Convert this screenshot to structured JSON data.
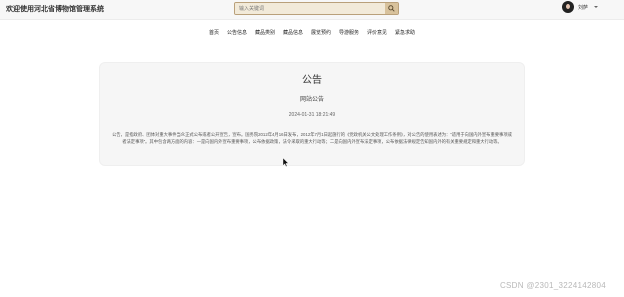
{
  "header": {
    "site_title": "欢迎使用河北省博物馆管理系统",
    "search_placeholder": "输入关键词",
    "username": "刘萨"
  },
  "nav": {
    "items": [
      "首页",
      "公告信息",
      "藏品类别",
      "藏品信息",
      "展览预约",
      "导游服务",
      "评价意见",
      "紧急求助"
    ]
  },
  "notice": {
    "heading": "公告",
    "title": "网站公告",
    "time": "2024-01-31 18:21:49",
    "body": "公告，是指政府、团体对重大事件当众正式公布或者公开宣告，宣布。国务院2012年4月16日发布，2012年7月1日起施行的《党政机关公文处理工作条例》，对公告的使用表述为：“适用于向国内外宣布重要事项或者法定事项”。其中包含两方面的内容：一是向国内外宣布重要事项，公布依据政策，法令采取的重大行动等；二是向国内外宣布法定事项，公布依据法律规定告知国内外的有关重要规定和重大行动等。"
  },
  "watermark": "CSDN @2301_3224142804"
}
